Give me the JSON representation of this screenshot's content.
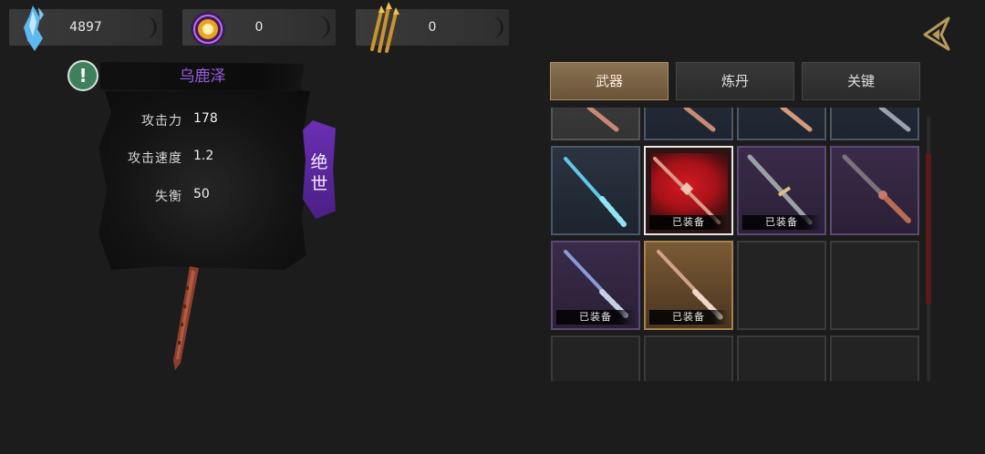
{
  "currencies": [
    {
      "icon": "blue-crystal-icon",
      "value": "4897"
    },
    {
      "icon": "golden-orb-icon",
      "value": "0"
    },
    {
      "icon": "golden-arrows-icon",
      "value": "0"
    }
  ],
  "back_button_icon": "back-arrow-icon",
  "weapon": {
    "name": "乌鹿泽",
    "rank": "绝世",
    "stats": [
      {
        "label": "攻击力",
        "value": "178"
      },
      {
        "label": "攻击速度",
        "value": "1.2"
      },
      {
        "label": "失衡",
        "value": "50"
      }
    ]
  },
  "tabs": [
    {
      "label": "武器",
      "active": true
    },
    {
      "label": "炼丹",
      "active": false
    },
    {
      "label": "关键",
      "active": false
    }
  ],
  "equipped_label": "已装备",
  "colors": {
    "rank_purple": "#6b2fb2",
    "name_purple": "#9b5fe0",
    "tab_active": "#8a7153",
    "rarity_blue": "#2b3440",
    "rarity_purple": "#3a2b4a",
    "rarity_gold": "#7a5a36"
  }
}
